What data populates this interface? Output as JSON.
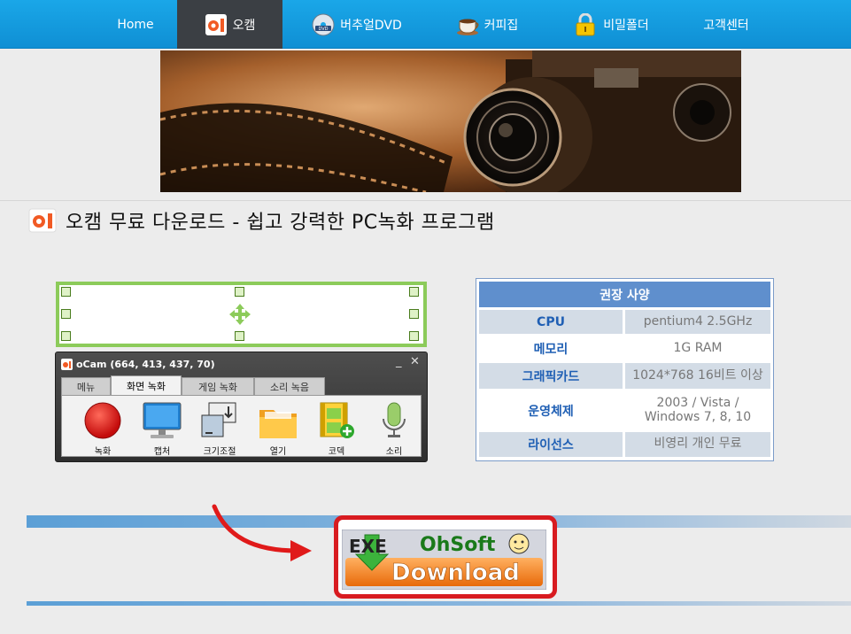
{
  "nav": {
    "items": [
      {
        "label": "Home",
        "icon": "none",
        "active": false
      },
      {
        "label": "오캠",
        "icon": "ocam-logo-icon",
        "active": true
      },
      {
        "label": "버추얼DVD",
        "icon": "dvd-icon",
        "active": false
      },
      {
        "label": "커피집",
        "icon": "coffee-cup-icon",
        "active": false
      },
      {
        "label": "비밀폴더",
        "icon": "padlock-icon",
        "active": false
      },
      {
        "label": "고객센터",
        "icon": "none",
        "active": false
      }
    ]
  },
  "page": {
    "title": "오캠 무료 다운로드 - 쉽고 강력한 PC녹화 프로그램"
  },
  "ocam_window": {
    "title": "oCam (664, 413, 437, 70)",
    "tabs": [
      "메뉴",
      "화면 녹화",
      "게임 녹화",
      "소리 녹음"
    ],
    "active_tab": "화면 녹화",
    "tools": [
      {
        "label": "녹화",
        "icon": "record-button-icon"
      },
      {
        "label": "캡처",
        "icon": "monitor-icon"
      },
      {
        "label": "크기조절",
        "icon": "resize-icon"
      },
      {
        "label": "열기",
        "icon": "folder-icon"
      },
      {
        "label": "코덱",
        "icon": "codec-film-icon"
      },
      {
        "label": "소리",
        "icon": "microphone-icon"
      }
    ]
  },
  "spec": {
    "header": "권장 사양",
    "rows": [
      {
        "key": "CPU",
        "value": "pentium4 2.5GHz"
      },
      {
        "key": "메모리",
        "value": "1G RAM"
      },
      {
        "key": "그래픽카드",
        "value": "1024*768 16비트 이상"
      },
      {
        "key": "운영체제",
        "value": "2003 / Vista / Windows 7, 8, 10"
      },
      {
        "key": "라이선스",
        "value": "비영리 개인 무료"
      }
    ]
  },
  "download": {
    "exe_label": "EXE",
    "brand": "OhSoft",
    "button_label": "Download"
  },
  "colors": {
    "nav": "#1aa7e8",
    "nav_active": "#3b3f44",
    "spec_header": "#5f8fcd",
    "spec_key": "#1f5fb4",
    "download_orange": "#f07c1a",
    "highlight_red": "#d81b20"
  }
}
